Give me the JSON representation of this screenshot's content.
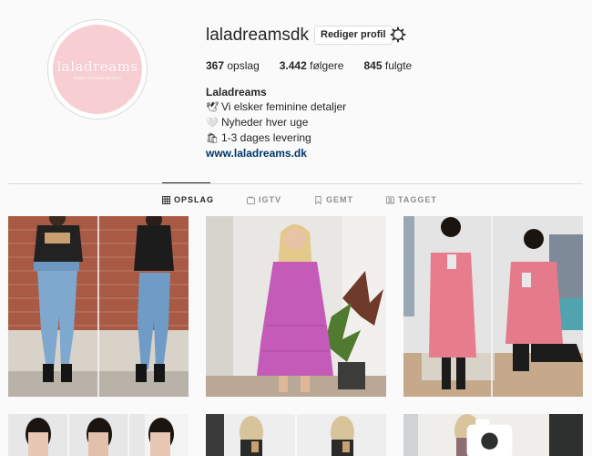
{
  "profile": {
    "username": "laladreamsdk",
    "edit_label": "Rediger profil",
    "avatar_logo": "laladreams",
    "avatar_tagline": "SIMPLY FEMININE DETAILS",
    "posts_count": "367",
    "posts_label": "opslag",
    "followers_count": "3.442",
    "followers_label": "følgere",
    "following_count": "845",
    "following_label": "fulgte"
  },
  "bio": {
    "name": "Laladreams",
    "line1_emoji": "🕊",
    "line1": "Vi elsker feminine detaljer",
    "line2_emoji": "🤍",
    "line2": "Nyheder hver uge",
    "line3_emoji": "🛍",
    "line3": "1-3 dages levering",
    "link": "www.laladreams.dk"
  },
  "tabs": [
    {
      "label": "OPSLAG",
      "icon": "grid-icon",
      "active": true
    },
    {
      "label": "IGTV",
      "icon": "igtv-icon",
      "active": false
    },
    {
      "label": "GEMT",
      "icon": "bookmark-icon",
      "active": false
    },
    {
      "label": "TAGGET",
      "icon": "tagged-icon",
      "active": false
    }
  ],
  "colors": {
    "link": "#00376b",
    "avatar_bg": "#f7cfd3",
    "border": "#dbdbdb"
  }
}
